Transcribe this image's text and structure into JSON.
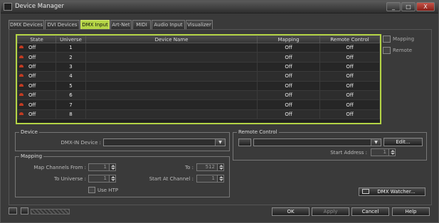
{
  "window": {
    "title": "Device Manager",
    "minimize": "_",
    "maximize": "□",
    "close": "X"
  },
  "tabs": [
    "DMX Devices",
    "DVI Devices",
    "DMX Input",
    "Art-Net",
    "MIDI",
    "Audio Input",
    "Visualizer"
  ],
  "active_tab": "DMX Input",
  "table": {
    "headers": [
      "State",
      "Universe",
      "Device Name",
      "Mapping",
      "Remote Control"
    ],
    "rows": [
      {
        "state": "Off",
        "universe": "1",
        "device": "",
        "mapping": "Off",
        "remote": "Off"
      },
      {
        "state": "Off",
        "universe": "2",
        "device": "",
        "mapping": "Off",
        "remote": "Off"
      },
      {
        "state": "Off",
        "universe": "3",
        "device": "",
        "mapping": "Off",
        "remote": "Off"
      },
      {
        "state": "Off",
        "universe": "4",
        "device": "",
        "mapping": "Off",
        "remote": "Off"
      },
      {
        "state": "Off",
        "universe": "5",
        "device": "",
        "mapping": "Off",
        "remote": "Off"
      },
      {
        "state": "Off",
        "universe": "6",
        "device": "",
        "mapping": "Off",
        "remote": "Off"
      },
      {
        "state": "Off",
        "universe": "7",
        "device": "",
        "mapping": "Off",
        "remote": "Off"
      },
      {
        "state": "Off",
        "universe": "8",
        "device": "",
        "mapping": "Off",
        "remote": "Off"
      }
    ]
  },
  "side": {
    "mapping": "Mapping",
    "remote": "Remote"
  },
  "device": {
    "group": "Device",
    "dmx_in_label": "DMX-IN Device :",
    "dmx_in_value": ""
  },
  "remote_control": {
    "group": "Remote Control",
    "edit": "Edit...",
    "start_address_label": "Start Address :",
    "start_address": "1"
  },
  "mapping": {
    "group": "Mapping",
    "map_from_label": "Map Channels From :",
    "map_from": "1",
    "to_label": "To :",
    "to": "512",
    "to_universe_label": "To Universe :",
    "to_universe": "1",
    "start_channel_label": "Start At Channel :",
    "start_channel": "1",
    "use_htp": "Use HTP"
  },
  "dmx_watcher": "DMX Watcher...",
  "footer": {
    "ok": "OK",
    "apply": "Apply",
    "cancel": "Cancel",
    "help": "Help"
  },
  "colors": {
    "accent": "#b4d445",
    "led_off": "#c23b22",
    "background": "#3a3a3a"
  }
}
